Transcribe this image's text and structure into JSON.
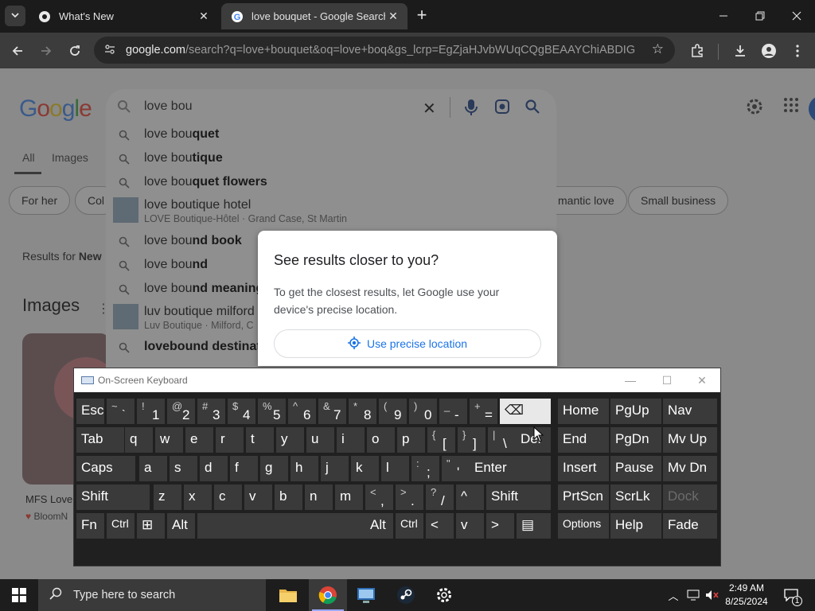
{
  "browser": {
    "tabs": [
      {
        "title": "What's New",
        "active": false
      },
      {
        "title": "love bouquet - Google Search",
        "active": true
      }
    ],
    "url_host": "google.com",
    "url_path": "/search?q=love+bouquet&oq=love+boq&gs_lcrp=EgZjaHJvbWUqCQgBEAAYChiABDIGCA..."
  },
  "google": {
    "logo": "Google",
    "query": "love bou",
    "suggestions": [
      {
        "prefix": "love bou",
        "bold": "quet",
        "sub": ""
      },
      {
        "prefix": "love bou",
        "bold": "tique",
        "sub": ""
      },
      {
        "prefix": "love bou",
        "bold": "quet flowers",
        "sub": ""
      },
      {
        "prefix": "love boutique hotel",
        "bold": "",
        "sub": "LOVE Boutique-Hôtel · Grand Case, St Martin"
      },
      {
        "prefix": "love bou",
        "bold": "nd book",
        "sub": ""
      },
      {
        "prefix": "love bou",
        "bold": "nd",
        "sub": ""
      },
      {
        "prefix": "love bou",
        "bold": "nd meaning",
        "sub": ""
      },
      {
        "prefix": "luv boutique milford",
        "bold": "",
        "sub": "Luv Boutique · Milford, C"
      },
      {
        "prefix": "",
        "bold": "lovebound destinat",
        "sub": ""
      }
    ],
    "nav_tabs": [
      "All",
      "Images"
    ],
    "chips": [
      "For her",
      "Col",
      "mantic love",
      "Small business"
    ],
    "results_for_prefix": "Results for ",
    "results_for_place": "New",
    "images_heading": "Images",
    "image_caption": "MFS Love",
    "image_source": "BloomN"
  },
  "dialog": {
    "title": "See results closer to you?",
    "body": "To get the closest results, let Google use your device's precise location.",
    "button": "Use precise location"
  },
  "osk": {
    "title": "On-Screen Keyboard",
    "rows": [
      [
        {
          "m": "Esc"
        },
        {
          "sh": "~",
          "lo": "`",
          "cls": "sm"
        },
        {
          "sh": "!",
          "lo": "1"
        },
        {
          "sh": "@",
          "lo": "2"
        },
        {
          "sh": "#",
          "lo": "3"
        },
        {
          "sh": "$",
          "lo": "4"
        },
        {
          "sh": "%",
          "lo": "5"
        },
        {
          "sh": "^",
          "lo": "6"
        },
        {
          "sh": "&",
          "lo": "7"
        },
        {
          "sh": "*",
          "lo": "8"
        },
        {
          "sh": "(",
          "lo": "9"
        },
        {
          "sh": ")",
          "lo": "0"
        },
        {
          "sh": "_",
          "lo": "-"
        },
        {
          "sh": "+",
          "lo": "="
        },
        {
          "m": "⌫",
          "light": true
        },
        {
          "m": "Home"
        },
        {
          "m": "PgUp"
        },
        {
          "m": "Nav"
        }
      ],
      [
        {
          "m": "Tab"
        },
        {
          "m": "q"
        },
        {
          "m": "w"
        },
        {
          "m": "e"
        },
        {
          "m": "r"
        },
        {
          "m": "t"
        },
        {
          "m": "y"
        },
        {
          "m": "u"
        },
        {
          "m": "i"
        },
        {
          "m": "o"
        },
        {
          "m": "p"
        },
        {
          "sh": "{",
          "lo": "["
        },
        {
          "sh": "}",
          "lo": "]"
        },
        {
          "sh": "|",
          "lo": "\\"
        },
        {
          "m": "Del"
        },
        {
          "m": "End"
        },
        {
          "m": "PgDn"
        },
        {
          "m": "Mv Up"
        }
      ],
      [
        {
          "m": "Caps"
        },
        {
          "m": "a"
        },
        {
          "m": "s"
        },
        {
          "m": "d"
        },
        {
          "m": "f"
        },
        {
          "m": "g"
        },
        {
          "m": "h"
        },
        {
          "m": "j"
        },
        {
          "m": "k"
        },
        {
          "m": "l"
        },
        {
          "sh": ":",
          "lo": ";"
        },
        {
          "sh": "\"",
          "lo": "'"
        },
        {
          "m": "Enter"
        },
        {
          "m": "Insert"
        },
        {
          "m": "Pause"
        },
        {
          "m": "Mv Dn"
        }
      ],
      [
        {
          "m": "Shift"
        },
        {
          "m": "z"
        },
        {
          "m": "x"
        },
        {
          "m": "c"
        },
        {
          "m": "v"
        },
        {
          "m": "b"
        },
        {
          "m": "n"
        },
        {
          "m": "m"
        },
        {
          "sh": "<",
          "lo": ","
        },
        {
          "sh": ">",
          "lo": "."
        },
        {
          "sh": "?",
          "lo": "/"
        },
        {
          "m": "^"
        },
        {
          "m": "Shift"
        },
        {
          "m": "PrtScn"
        },
        {
          "m": "ScrLk"
        },
        {
          "m": "Dock",
          "dim": true
        }
      ],
      [
        {
          "m": "Fn"
        },
        {
          "m": "Ctrl",
          "cls": "sm"
        },
        {
          "m": "⊞",
          "icon": "windows-logo-icon"
        },
        {
          "m": "Alt"
        },
        {
          "m": ""
        },
        {
          "m": "Alt"
        },
        {
          "m": "Ctrl",
          "cls": "sm"
        },
        {
          "m": "<"
        },
        {
          "m": "v"
        },
        {
          "m": ">"
        },
        {
          "m": "▤",
          "icon": "menu-key-icon"
        },
        {
          "m": "Options",
          "cls": "sm"
        },
        {
          "m": "Help"
        },
        {
          "m": "Fade"
        }
      ]
    ]
  },
  "taskbar": {
    "search_placeholder": "Type here to search",
    "time": "2:49 AM",
    "date": "8/25/2024",
    "notification_count": "1"
  },
  "colors": {
    "chrome_dark": "#1b1b1b",
    "chrome_toolbar": "#3c3c3c",
    "page_scrim": "#8a8a8a",
    "google_blue": "#1a73e8",
    "osk_key": "#3a3a3a"
  }
}
